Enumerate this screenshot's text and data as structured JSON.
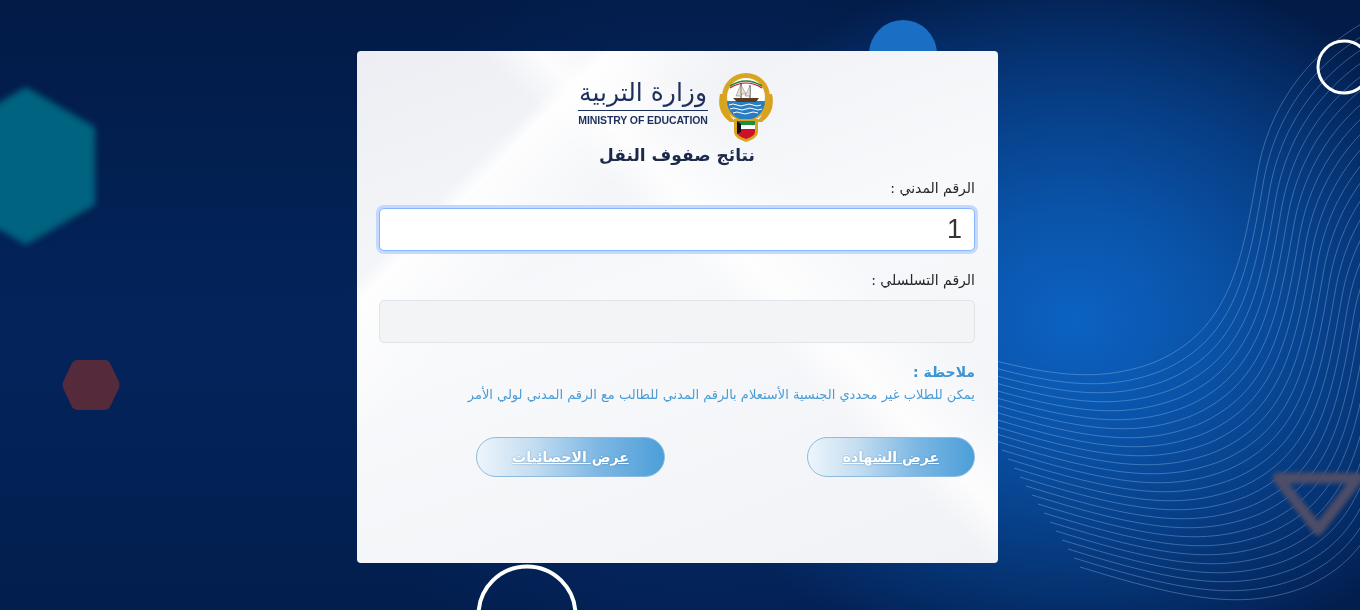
{
  "logo": {
    "arabic_name": "وزارة التربية",
    "english_name": "MINISTRY OF EDUCATION"
  },
  "title": "نتائج صفوف النقل",
  "fields": [
    {
      "label": "الرقم المدني :",
      "value": "1",
      "focused": true,
      "disabled": false
    },
    {
      "label": "الرقم التسلسلي :",
      "focused": false,
      "disabled": true
    }
  ],
  "note": {
    "heading": "ملاحظة :",
    "text": "يمكن للطلاب غير محددي الجنسية الأستعلام بالرقم المدني للطالب مع الرقم المدني لولي الأمر"
  },
  "buttons": [
    {
      "label": "عرض الشهادة"
    },
    {
      "label": "عرض الاحصائيات"
    }
  ]
}
